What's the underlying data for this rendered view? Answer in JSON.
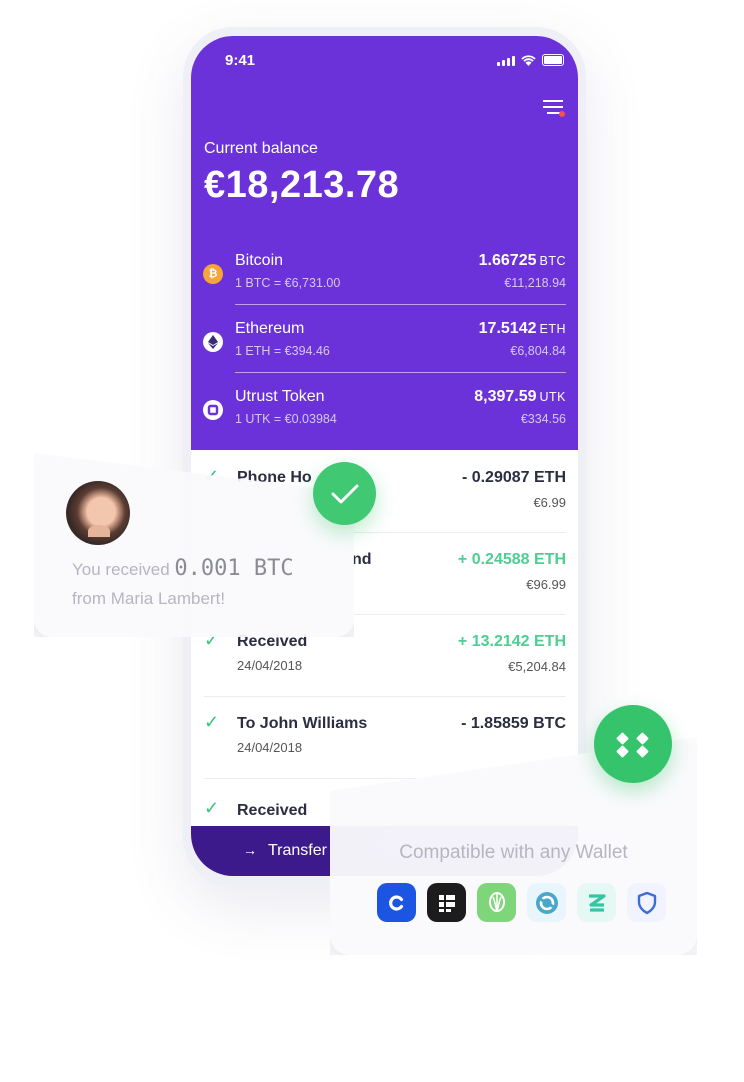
{
  "status_bar": {
    "time": "9:41"
  },
  "balance": {
    "label": "Current balance",
    "value": "€18,213.78"
  },
  "coins": [
    {
      "name": "Bitcoin",
      "rate": "1 BTC = €6,731.00",
      "amount": "1.66725",
      "unit": "BTC",
      "eur": "€11,218.94",
      "icon": "bitcoin-icon",
      "color": "#f7a53b"
    },
    {
      "name": "Ethereum",
      "rate": "1 ETH = €394.46",
      "amount": "17.5142",
      "unit": "ETH",
      "eur": "€6,804.84",
      "icon": "ethereum-icon",
      "color": "#ffffff"
    },
    {
      "name": "Utrust Token",
      "rate": "1 UTK = €0.03984",
      "amount": "8,397.59",
      "unit": "UTK",
      "eur": "€334.56",
      "icon": "utrust-icon",
      "color": "#ffffff"
    }
  ],
  "transactions": [
    {
      "name": "Phone Ho",
      "date": "",
      "amount": "- 0.29087 ETH",
      "eur": "€6.99",
      "direction": "out"
    },
    {
      "name": "nd",
      "date": "",
      "amount": "+ 0.24588 ETH",
      "eur": "€96.99",
      "direction": "in"
    },
    {
      "name": "Received",
      "date": "24/04/2018",
      "amount": "+ 13.2142 ETH",
      "eur": "€5,204.84",
      "direction": "in"
    },
    {
      "name": "To John Williams",
      "date": "24/04/2018",
      "amount": "- 1.85859 BTC",
      "eur": "",
      "direction": "out"
    },
    {
      "name": "Received",
      "date": "",
      "amount": "",
      "eur": "",
      "direction": "in"
    }
  ],
  "bottom_bar": {
    "label": "Transfer",
    "arrow": "→"
  },
  "notification": {
    "prefix": "You received",
    "amount": "0.001 BTC",
    "suffix": "from Maria Lambert!"
  },
  "compat": {
    "title": "Compatible with any Wallet",
    "wallets": [
      {
        "icon": "coinbase-wallet-icon",
        "bg": "#1b55e2"
      },
      {
        "icon": "ledger-wallet-icon",
        "bg": "#1c1c1c"
      },
      {
        "icon": "utrust-wallet-icon",
        "bg": "#7fd67a"
      },
      {
        "icon": "exodus-wallet-icon",
        "bg": "#e8f6fb"
      },
      {
        "icon": "zengo-wallet-icon",
        "bg": "#e5f8f4"
      },
      {
        "icon": "trust-wallet-icon",
        "bg": "#f1f4ff"
      }
    ]
  },
  "colors": {
    "primary_purple": "#6a32d8",
    "success_green": "#41c872",
    "positive_text": "#4ccf90"
  }
}
